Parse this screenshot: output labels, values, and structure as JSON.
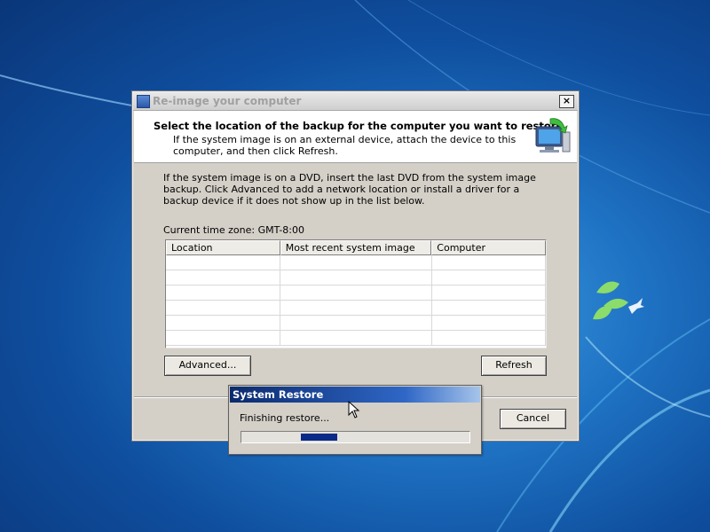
{
  "dialog": {
    "title": "Re-image your computer",
    "header_title": "Select the location of the backup for the computer you want to restore",
    "header_sub": "If the system image is on an external device, attach the device to this computer, and then click Refresh.",
    "instructions": "If the system image is on a DVD, insert the last DVD from the system image backup. Click Advanced to add a network location or install a driver for a backup device if it does not show up in the list below.",
    "timezone": "Current time zone: GMT-8:00",
    "columns": [
      "Location",
      "Most recent system image",
      "Computer"
    ],
    "advanced_label": "Advanced...",
    "refresh_label": "Refresh",
    "cancel_label": "Cancel",
    "close_glyph": "×"
  },
  "popup": {
    "title": "System Restore",
    "status": "Finishing restore...",
    "progress_chunk_start": 0.26,
    "progress_chunk_end": 0.42
  },
  "icons": {
    "title_icon": "window-icon",
    "header_icon": "computer-restore-icon",
    "cursor": "arrow-cursor-icon"
  }
}
